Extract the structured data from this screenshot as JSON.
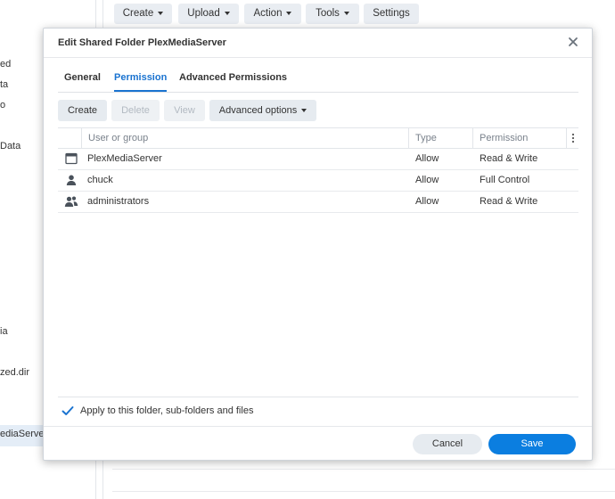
{
  "background": {
    "sidebar_items": [
      "ed",
      "ta",
      "o",
      "Data",
      "ia",
      "zed.dir",
      "ediaServer"
    ],
    "toolbar": {
      "create_label": "Create",
      "upload_label": "Upload",
      "action_label": "Action",
      "tools_label": "Tools",
      "settings_label": "Settings"
    }
  },
  "dialog": {
    "title": "Edit Shared Folder PlexMediaServer",
    "tabs": [
      {
        "label": "General",
        "active": false
      },
      {
        "label": "Permission",
        "active": true
      },
      {
        "label": "Advanced Permissions",
        "active": false
      }
    ],
    "toolbar": {
      "create_label": "Create",
      "delete_label": "Delete",
      "view_label": "View",
      "advanced_label": "Advanced options"
    },
    "grid": {
      "columns": [
        "User or group",
        "Type",
        "Permission"
      ],
      "rows": [
        {
          "icon": "app-window-icon",
          "name": "PlexMediaServer",
          "type": "Allow",
          "permission": "Read & Write"
        },
        {
          "icon": "user-icon",
          "name": "chuck",
          "type": "Allow",
          "permission": "Full Control"
        },
        {
          "icon": "group-icon",
          "name": "administrators",
          "type": "Allow",
          "permission": "Read & Write"
        }
      ]
    },
    "apply_label": "Apply to this folder, sub-folders and files",
    "apply_checked": true,
    "cancel_label": "Cancel",
    "save_label": "Save"
  },
  "colors": {
    "accent": "#1a73d0",
    "save_button": "#0b7ee0",
    "button_bg": "#e6ebf0"
  }
}
